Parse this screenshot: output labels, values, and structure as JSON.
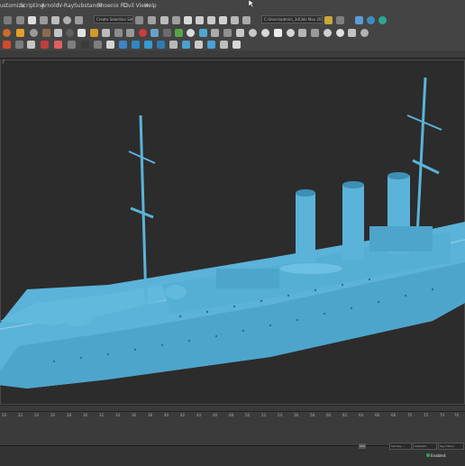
{
  "menu": {
    "items": [
      "ustomize",
      "Scripting",
      "Arnold",
      "V-Ray",
      "Substance",
      "Phoenix FD",
      "Civil View",
      "Help"
    ]
  },
  "toolbar": {
    "selection_set_placeholder": "Create Selection Set",
    "project_path": "C:\\Users\\admin\\_3d\\3ds Max 2020"
  },
  "viewport": {
    "label": "/"
  },
  "timeline": {
    "ticks": [
      "20",
      "22",
      "24",
      "26",
      "28",
      "30",
      "32",
      "34",
      "36",
      "38",
      "40",
      "42",
      "44",
      "46",
      "48",
      "50",
      "52",
      "54",
      "56",
      "58",
      "60",
      "62",
      "64",
      "66",
      "68",
      "70",
      "72",
      "74",
      "76",
      "78"
    ]
  },
  "status": {
    "field1": "Set Key ...",
    "field2": "Selected",
    "field3": "Key Filters",
    "enabled_label": "Enabled:",
    "enabled_color": "#2aa84a"
  },
  "colors": {
    "ship": "#5bb3d9",
    "ship_shadow": "#3d8fb5",
    "viewport_bg": "#2c2c2c",
    "ui_panel": "#444444"
  }
}
